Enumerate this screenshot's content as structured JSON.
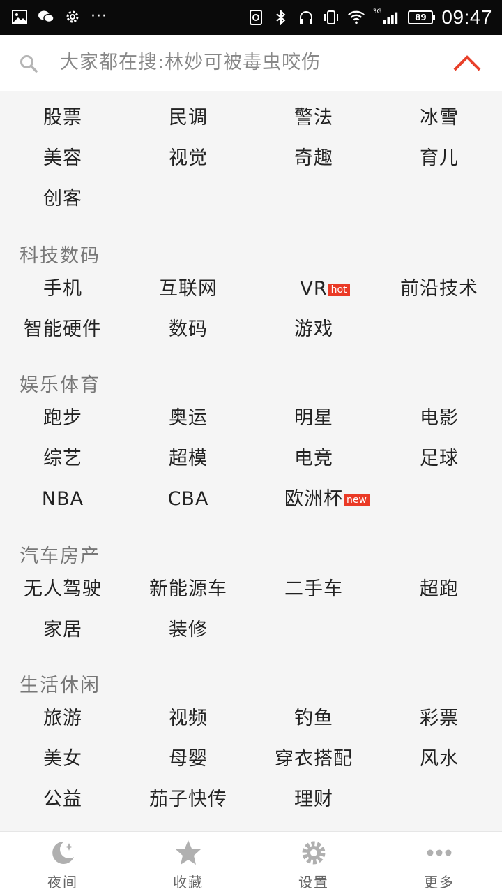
{
  "status_bar": {
    "time": "09:47",
    "battery": "89",
    "network": "3G",
    "menu_dots": "···"
  },
  "search": {
    "prefix": "大家都在搜:",
    "query": "林妙可被毒虫咬伤",
    "accent_color": "#e8402a"
  },
  "top_group": {
    "items": [
      {
        "label": "股票"
      },
      {
        "label": "民调"
      },
      {
        "label": "警法"
      },
      {
        "label": "冰雪"
      },
      {
        "label": "美容"
      },
      {
        "label": "视觉"
      },
      {
        "label": "奇趣"
      },
      {
        "label": "育儿"
      },
      {
        "label": "创客"
      }
    ]
  },
  "tech": {
    "title": "科技数码",
    "items": [
      {
        "label": "手机"
      },
      {
        "label": "互联网"
      },
      {
        "label": "VR",
        "tag": "hot"
      },
      {
        "label": "前沿技术"
      },
      {
        "label": "智能硬件"
      },
      {
        "label": "数码"
      },
      {
        "label": "游戏"
      }
    ]
  },
  "entertainment": {
    "title": "娱乐体育",
    "items": [
      {
        "label": "跑步"
      },
      {
        "label": "奥运"
      },
      {
        "label": "明星"
      },
      {
        "label": "电影"
      },
      {
        "label": "综艺"
      },
      {
        "label": "超模"
      },
      {
        "label": "电竞"
      },
      {
        "label": "足球"
      },
      {
        "label": "NBA"
      },
      {
        "label": "CBA"
      },
      {
        "label": "欧洲杯",
        "tag": "new"
      }
    ]
  },
  "auto": {
    "title": "汽车房产",
    "items": [
      {
        "label": "无人驾驶"
      },
      {
        "label": "新能源车"
      },
      {
        "label": "二手车"
      },
      {
        "label": "超跑"
      },
      {
        "label": "家居"
      },
      {
        "label": "装修"
      }
    ]
  },
  "life": {
    "title": "生活休闲",
    "items": [
      {
        "label": "旅游"
      },
      {
        "label": "视频"
      },
      {
        "label": "钓鱼"
      },
      {
        "label": "彩票"
      },
      {
        "label": "美女"
      },
      {
        "label": "母婴"
      },
      {
        "label": "穿衣搭配"
      },
      {
        "label": "风水"
      },
      {
        "label": "公益"
      },
      {
        "label": "茄子快传"
      },
      {
        "label": "理财"
      }
    ]
  },
  "bottom_bar": {
    "items": [
      {
        "label": "夜间",
        "icon": "moon-icon"
      },
      {
        "label": "收藏",
        "icon": "star-icon"
      },
      {
        "label": "设置",
        "icon": "gear-icon"
      },
      {
        "label": "更多",
        "icon": "more-dots-icon"
      }
    ],
    "icon_color": "#b0b0b0"
  }
}
